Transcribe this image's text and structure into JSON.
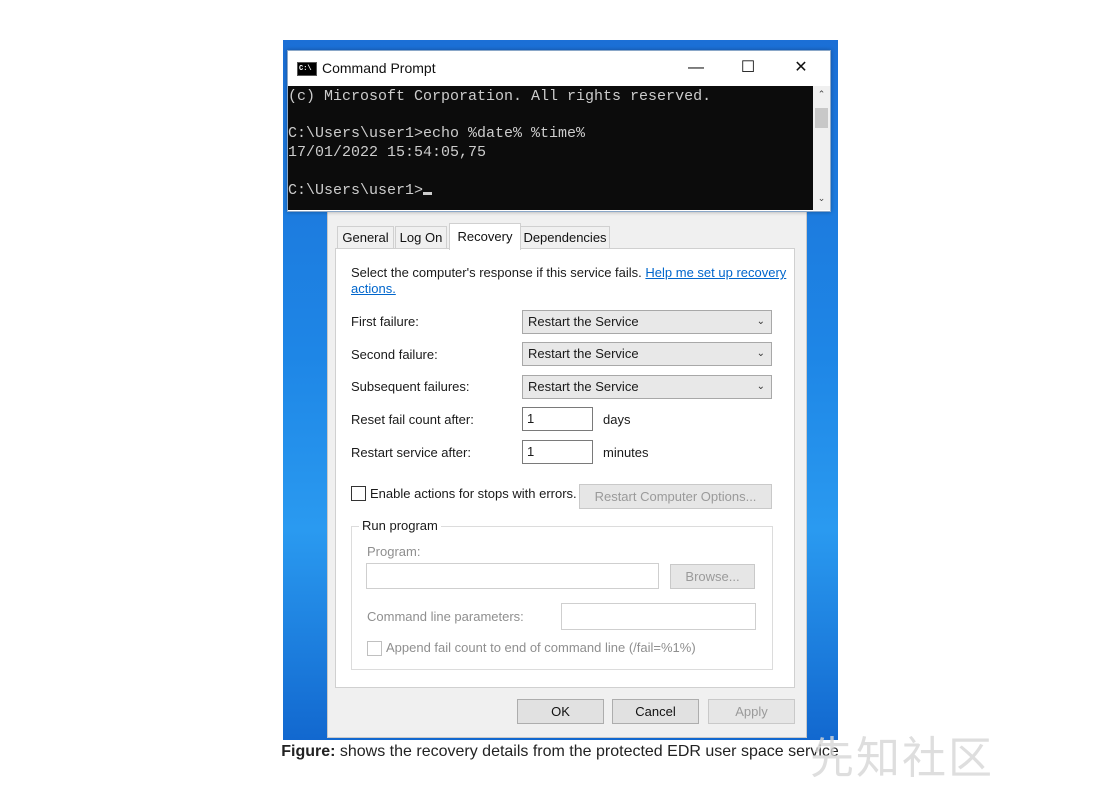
{
  "cmd": {
    "title": "Command Prompt",
    "icon_label": "C:\\",
    "lines": [
      "(c) Microsoft Corporation. All rights reserved.",
      "",
      "C:\\Users\\user1>echo %date% %time%",
      "17/01/2022 15:54:05,75",
      "",
      "C:\\Users\\user1>"
    ]
  },
  "tabs": [
    {
      "label": "General"
    },
    {
      "label": "Log On"
    },
    {
      "label": "Recovery"
    },
    {
      "label": "Dependencies"
    }
  ],
  "recovery": {
    "intro": "Select the computer's response if this service fails.",
    "help_link_line1": "Help me set up recovery",
    "help_link_line2": "actions.",
    "first_failure_label": "First failure:",
    "first_failure_value": "Restart the Service",
    "second_failure_label": "Second failure:",
    "second_failure_value": "Restart the Service",
    "subsequent_label": "Subsequent failures:",
    "subsequent_value": "Restart the Service",
    "reset_label": "Reset fail count after:",
    "reset_value": "1",
    "reset_unit": "days",
    "restart_label": "Restart service after:",
    "restart_value": "1",
    "restart_unit": "minutes",
    "enable_actions_label": "Enable actions for stops with errors.",
    "restart_computer_button": "Restart Computer Options...",
    "run_program_title": "Run program",
    "program_label": "Program:",
    "browse_button": "Browse...",
    "cmdline_label": "Command line parameters:",
    "append_label": "Append fail count to end of command line (/fail=%1%)"
  },
  "buttons": {
    "ok": "OK",
    "cancel": "Cancel",
    "apply": "Apply"
  },
  "caption": {
    "bold": "Figure:",
    "text": " shows the recovery details from the protected EDR user space service"
  },
  "watermark": "先知社区"
}
